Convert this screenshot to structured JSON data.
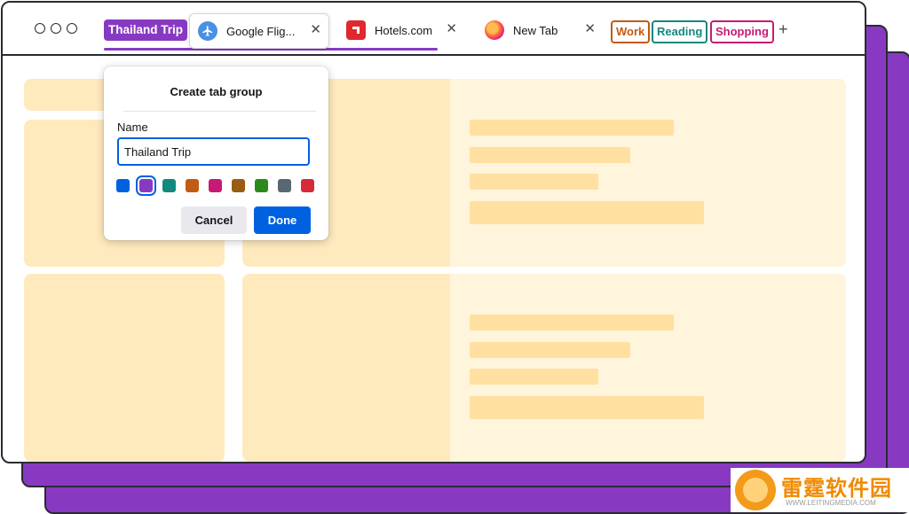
{
  "tabbar": {
    "group_label": "Thailand Trip",
    "tabs": [
      {
        "title": "Google Flig...",
        "favicon": "airplane-icon"
      },
      {
        "title": "Hotels.com",
        "favicon": "hotels-icon"
      },
      {
        "title": "New Tab",
        "favicon": "firefox-icon"
      }
    ],
    "close_glyph": "✕",
    "other_groups": [
      "Work",
      "Reading",
      "Shopping"
    ],
    "new_tab_glyph": "+"
  },
  "dialog": {
    "title": "Create tab group",
    "name_label": "Name",
    "name_value": "Thailand Trip",
    "colors": [
      "#0061e0",
      "#8839c2",
      "#12897e",
      "#c25b12",
      "#c81a75",
      "#9a5b12",
      "#2c8a1a",
      "#5b6770",
      "#d62a3a"
    ],
    "selected_color": "#8839c2",
    "cancel_label": "Cancel",
    "done_label": "Done"
  },
  "watermark": {
    "text": "雷霆软件园",
    "url": "WWW.LEITINGMEDIA.COM"
  }
}
